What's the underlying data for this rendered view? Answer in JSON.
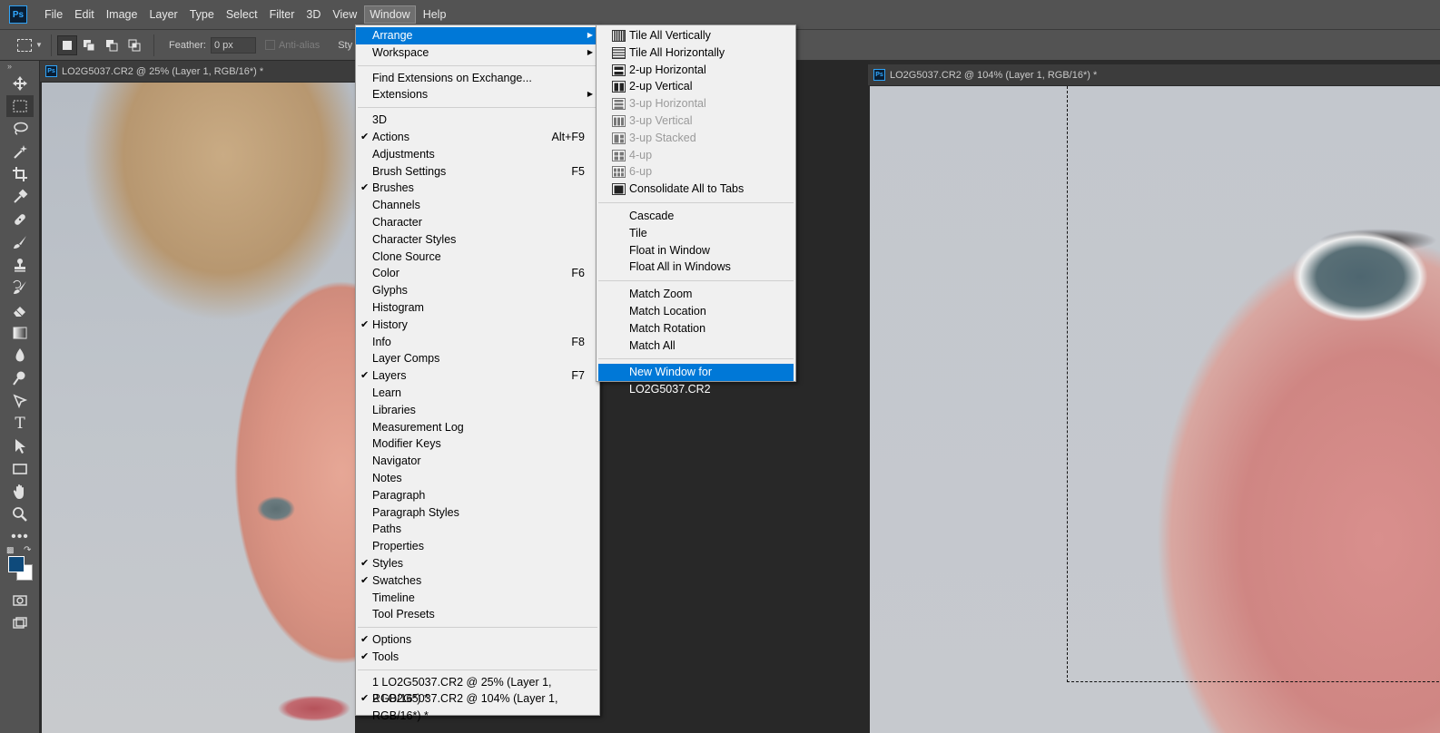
{
  "menubar": {
    "logo": "Ps",
    "items": [
      "File",
      "Edit",
      "Image",
      "Layer",
      "Type",
      "Select",
      "Filter",
      "3D",
      "View",
      "Window",
      "Help"
    ],
    "active_item": "Window"
  },
  "options": {
    "feather_label": "Feather:",
    "feather_value": "0 px",
    "antialias_label": "Anti-alias",
    "style_label": "Sty"
  },
  "documents": {
    "left_tab": "LO2G5037.CR2 @ 25% (Layer 1, RGB/16*) *",
    "right_tab": "LO2G5037.CR2 @ 104% (Layer 1, RGB/16*) *"
  },
  "window_menu": {
    "groups": [
      [
        {
          "label": "Arrange",
          "submenu": true,
          "highlighted": true
        },
        {
          "label": "Workspace",
          "submenu": true
        }
      ],
      [
        {
          "label": "Find Extensions on Exchange..."
        },
        {
          "label": "Extensions",
          "submenu": true
        }
      ],
      [
        {
          "label": "3D"
        },
        {
          "label": "Actions",
          "checked": true,
          "shortcut": "Alt+F9"
        },
        {
          "label": "Adjustments"
        },
        {
          "label": "Brush Settings",
          "shortcut": "F5"
        },
        {
          "label": "Brushes",
          "checked": true
        },
        {
          "label": "Channels"
        },
        {
          "label": "Character"
        },
        {
          "label": "Character Styles"
        },
        {
          "label": "Clone Source"
        },
        {
          "label": "Color",
          "shortcut": "F6"
        },
        {
          "label": "Glyphs"
        },
        {
          "label": "Histogram"
        },
        {
          "label": "History",
          "checked": true
        },
        {
          "label": "Info",
          "shortcut": "F8"
        },
        {
          "label": "Layer Comps"
        },
        {
          "label": "Layers",
          "checked": true,
          "shortcut": "F7"
        },
        {
          "label": "Learn"
        },
        {
          "label": "Libraries"
        },
        {
          "label": "Measurement Log"
        },
        {
          "label": "Modifier Keys"
        },
        {
          "label": "Navigator"
        },
        {
          "label": "Notes"
        },
        {
          "label": "Paragraph"
        },
        {
          "label": "Paragraph Styles"
        },
        {
          "label": "Paths"
        },
        {
          "label": "Properties"
        },
        {
          "label": "Styles",
          "checked": true
        },
        {
          "label": "Swatches",
          "checked": true
        },
        {
          "label": "Timeline"
        },
        {
          "label": "Tool Presets"
        }
      ],
      [
        {
          "label": "Options",
          "checked": true
        },
        {
          "label": "Tools",
          "checked": true
        }
      ],
      [
        {
          "label": "1 LO2G5037.CR2 @ 25% (Layer 1, RGB/16*) *"
        },
        {
          "label": "2 LO2G5037.CR2 @ 104% (Layer 1, RGB/16*) *",
          "checked": true
        }
      ]
    ]
  },
  "arrange_menu": {
    "groups": [
      [
        {
          "label": "Tile All Vertically",
          "icon": "tile-vertical-icon"
        },
        {
          "label": "Tile All Horizontally",
          "icon": "tile-horizontal-icon"
        },
        {
          "label": "2-up Horizontal",
          "icon": "2up-horizontal-icon"
        },
        {
          "label": "2-up Vertical",
          "icon": "2up-vertical-icon"
        },
        {
          "label": "3-up Horizontal",
          "icon": "3up-horizontal-icon",
          "disabled": true
        },
        {
          "label": "3-up Vertical",
          "icon": "3up-vertical-icon",
          "disabled": true
        },
        {
          "label": "3-up Stacked",
          "icon": "3up-stacked-icon",
          "disabled": true
        },
        {
          "label": "4-up",
          "icon": "4up-icon",
          "disabled": true
        },
        {
          "label": "6-up",
          "icon": "6up-icon",
          "disabled": true
        },
        {
          "label": "Consolidate All to Tabs",
          "icon": "consolidate-tabs-icon"
        }
      ],
      [
        {
          "label": "Cascade"
        },
        {
          "label": "Tile"
        },
        {
          "label": "Float in Window"
        },
        {
          "label": "Float All in Windows"
        }
      ],
      [
        {
          "label": "Match Zoom"
        },
        {
          "label": "Match Location"
        },
        {
          "label": "Match Rotation"
        },
        {
          "label": "Match All"
        }
      ],
      [
        {
          "label": "New Window for LO2G5037.CR2",
          "highlighted": true
        }
      ]
    ]
  },
  "tools": [
    "move-tool-icon",
    "rectangular-marquee-icon",
    "lasso-icon",
    "magic-wand-icon",
    "crop-icon",
    "eyedropper-icon",
    "healing-brush-icon",
    "brush-icon",
    "clone-stamp-icon",
    "history-brush-icon",
    "eraser-icon",
    "gradient-icon",
    "blur-icon",
    "dodge-icon",
    "pen-icon",
    "type-icon",
    "path-selection-icon",
    "rectangle-icon",
    "hand-icon",
    "zoom-icon",
    "more-tools-icon"
  ],
  "colors": {
    "foreground": "#0e4a7b",
    "background": "#ffffff",
    "highlight": "#0078d7"
  }
}
